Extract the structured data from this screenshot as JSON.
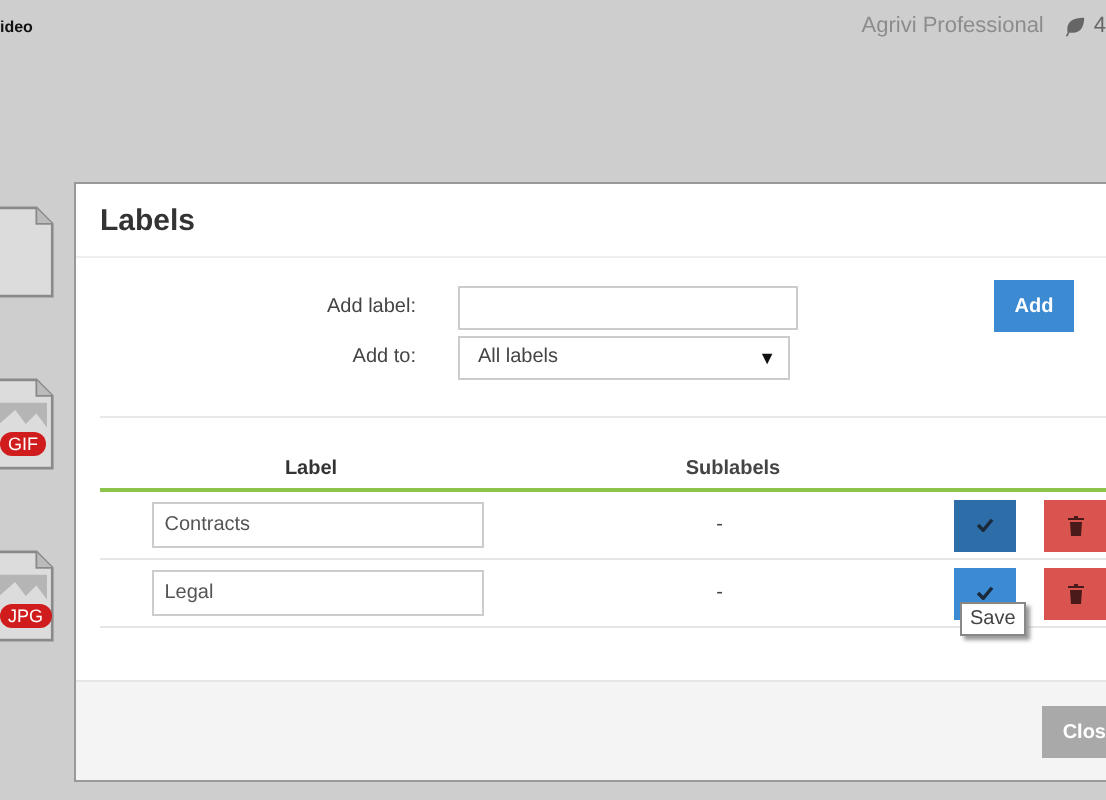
{
  "topbar": {
    "left_text": "ideo",
    "account": "Agrivi Professional",
    "count": "4"
  },
  "files": [
    {
      "kind": "blank"
    },
    {
      "kind": "image",
      "badge": "GIF"
    },
    {
      "kind": "image",
      "badge": "JPG"
    }
  ],
  "dialog": {
    "title": "Labels",
    "form": {
      "add_label": {
        "label": "Add label:"
      },
      "add_to": {
        "label": "Add to:",
        "value": "All labels",
        "arrow": "▼"
      },
      "add_button": "Add"
    },
    "table": {
      "columns": [
        "Label",
        "Sublabels"
      ],
      "rows": [
        {
          "label": "Contracts",
          "sublabels": "-",
          "save_pressed": true
        },
        {
          "label": "Legal",
          "sublabels": "-",
          "save_pressed": false,
          "tooltip": "Save"
        }
      ]
    },
    "close_button": "Clos"
  }
}
